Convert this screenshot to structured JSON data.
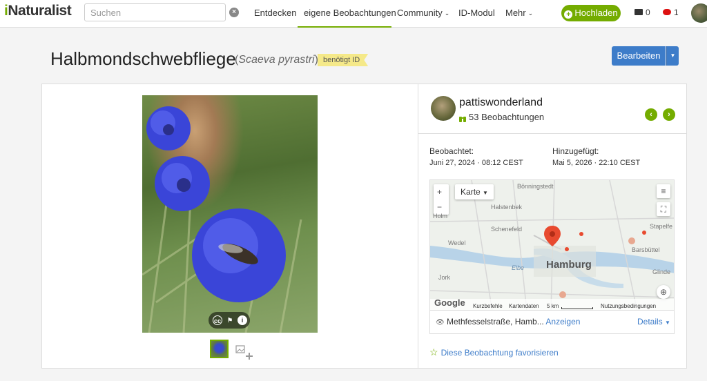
{
  "nav": {
    "logo_prefix": "i",
    "logo_rest": "Naturalist",
    "search_placeholder": "Suchen",
    "items": [
      {
        "label": "Entdecken"
      },
      {
        "label": "eigene Beobachtungen"
      },
      {
        "label": "Community"
      },
      {
        "label": "ID-Modul"
      },
      {
        "label": "Mehr"
      }
    ],
    "upload_label": "Hochladen",
    "messages_count": "0",
    "notifications_count": "1",
    "accent_color": "#74ac00"
  },
  "observation": {
    "common_name": "Halbmondschwebfliege",
    "scientific_name": "Scaeva pyrastri",
    "quality_badge": "benötigt ID",
    "edit_label": "Bearbeiten"
  },
  "user": {
    "name": "pattiswonderland",
    "observations": "53 Beobachtungen"
  },
  "details": {
    "observed_label": "Beobachtet:",
    "observed_value": "Juni 27, 2024 · 08:12 CEST",
    "added_label": "Hinzugefügt:",
    "added_value": "Mai 5, 2026 · 22:10 CEST"
  },
  "map": {
    "type_label": "Karte",
    "zoom_in": "+",
    "zoom_out": "−",
    "places": [
      "Bönningstedt",
      "Halstenbek",
      "Schenefeld",
      "Wedel",
      "Hamburg",
      "Elbe",
      "Jork",
      "Stapelfe",
      "Barsbüttel",
      "Glinde",
      "Holm"
    ],
    "footer": {
      "brand": "Google",
      "shortcuts": "Kurzbefehle",
      "map_data": "Kartendaten",
      "scale": "5 km",
      "terms": "Nutzungsbedingungen"
    }
  },
  "location": {
    "text": "Methfesselstraße, Hamb...",
    "show_link": "Anzeigen",
    "details_link": "Details"
  },
  "favorite_label": "Diese Beobachtung favorisieren"
}
